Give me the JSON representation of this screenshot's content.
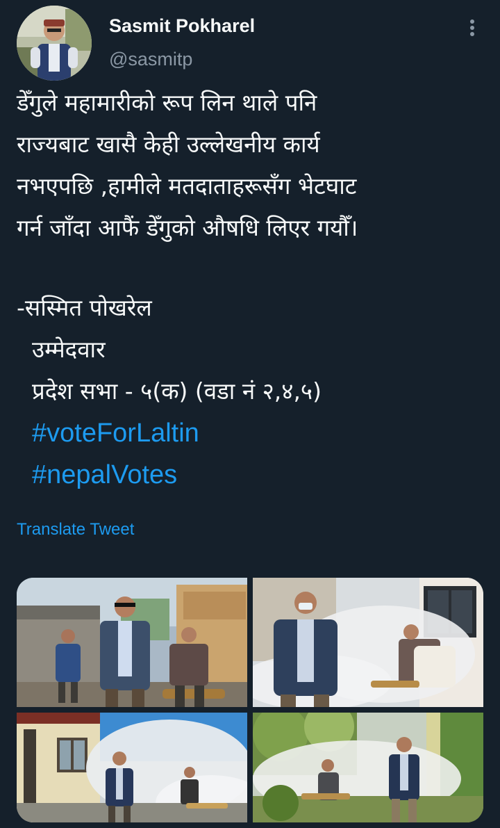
{
  "tweet": {
    "author": {
      "display_name": "Sasmit Pokharel",
      "handle": "@sasmitp"
    },
    "text_lines": [
      "डेँगुले महामारीको रूप लिन थाले पनि",
      "राज्यबाट खासै केही उल्लेखनीय कार्य",
      "नभएपछि ,हामीले मतदाताहरूसँग भेटघाट",
      "गर्न जाँदा आफैं डेँगुको औषधि लिएर गयौँ।"
    ],
    "signature": "-सस्मित पोखरेल",
    "role": "उम्मेदवार",
    "constituency": "प्रदेश सभा - ५(क) (वडा नं २,४,५)",
    "hashtags": [
      "#voteForLaltin",
      "#nepalVotes"
    ],
    "translate_label": "Translate Tweet",
    "icons": {
      "more": "more-vertical-icon"
    },
    "colors": {
      "background": "#15202b",
      "link": "#1d9bf0",
      "secondary_text": "#8b98a5",
      "primary_text": "#f7f9f9"
    }
  }
}
